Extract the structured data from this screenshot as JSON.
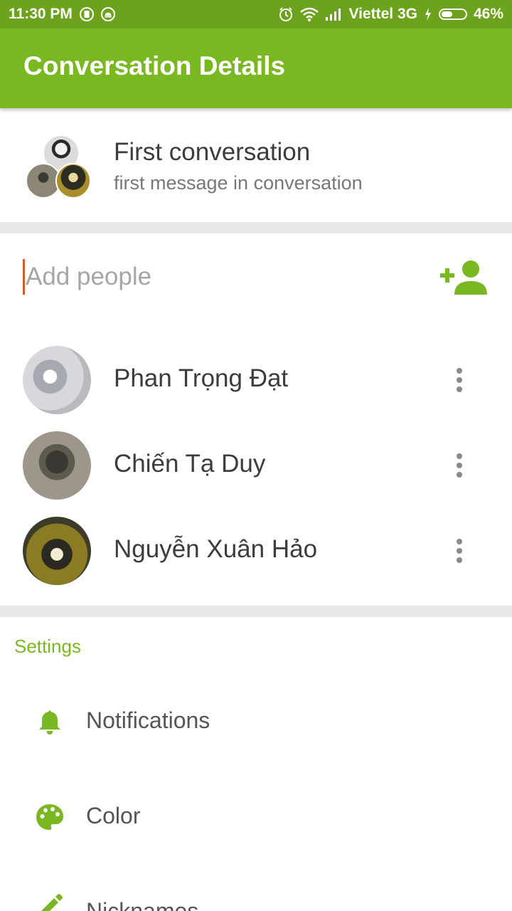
{
  "status_bar": {
    "time": "11:30 PM",
    "carrier": "Viettel 3G",
    "battery_text": "46%",
    "battery_level": 0.46
  },
  "app_bar": {
    "title": "Conversation Details"
  },
  "conversation": {
    "title": "First conversation",
    "subtitle": "first message in conversation"
  },
  "add_people": {
    "placeholder": "Add people"
  },
  "members": [
    {
      "name": "Phan Trọng Đạt"
    },
    {
      "name": "Chiến Tạ Duy"
    },
    {
      "name": "Nguyễn Xuân Hảo"
    }
  ],
  "settings": {
    "heading": "Settings",
    "items": [
      {
        "label": "Notifications",
        "icon": "bell-icon"
      },
      {
        "label": "Color",
        "icon": "palette-icon"
      },
      {
        "label": "Nicknames",
        "icon": "pencil-icon"
      }
    ]
  },
  "colors": {
    "status_bar": "#6da21c",
    "app_bar": "#7ab821",
    "accent": "#7ab821",
    "cursor": "#d35a2a"
  }
}
